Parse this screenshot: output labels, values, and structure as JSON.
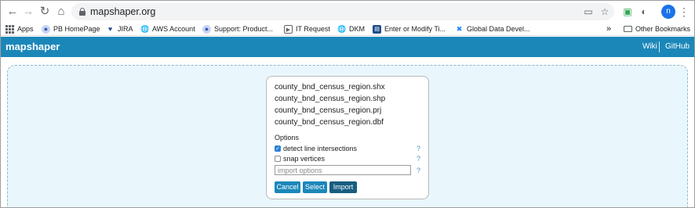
{
  "browser": {
    "url": "mapshaper.org",
    "profile_initial": "n"
  },
  "bookmarks": [
    {
      "label": "Apps",
      "icon": "apps-grid-icon"
    },
    {
      "label": "PB HomePage",
      "icon": "site-icon"
    },
    {
      "label": "JIRA",
      "icon": "jira-icon"
    },
    {
      "label": "AWS Account",
      "icon": "globe-icon"
    },
    {
      "label": "Support: Product...",
      "icon": "site-icon"
    },
    {
      "label": "IT Request",
      "icon": "it-icon"
    },
    {
      "label": "DKM",
      "icon": "globe-icon"
    },
    {
      "label": "Enter or Modify Ti...",
      "icon": "form-icon"
    },
    {
      "label": "Global Data Devel...",
      "icon": "confluence-icon"
    }
  ],
  "bookmarks_overflow": "»",
  "other_bookmarks": "Other Bookmarks",
  "app": {
    "logo": "mapshaper",
    "links": [
      "Wiki",
      "GitHub"
    ]
  },
  "import_panel": {
    "files": [
      "county_bnd_census_region.shx",
      "county_bnd_census_region.shp",
      "county_bnd_census_region.prj",
      "county_bnd_census_region.dbf"
    ],
    "options_title": "Options",
    "options": [
      {
        "label": "detect line intersections",
        "checked": true
      },
      {
        "label": "snap vertices",
        "checked": false
      }
    ],
    "help_mark": "?",
    "import_options_placeholder": "import options",
    "buttons": {
      "cancel": "Cancel",
      "select": "Select",
      "import": "Import"
    }
  },
  "colors": {
    "accent": "#1b87b9",
    "dropzone_bg": "#e9f7fd",
    "import_button": "#175d80"
  }
}
